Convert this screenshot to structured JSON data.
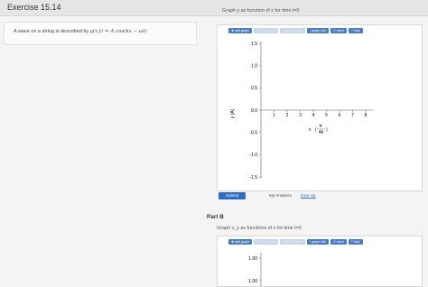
{
  "header": {
    "title": "Exercise 15.14"
  },
  "problem": {
    "text": "A wave on a string is described by",
    "formula": "y(x,t) = A cos(kx − ωt)"
  },
  "partA": {
    "question": "Graph y as function of x for time t=0",
    "toolbar": [
      {
        "label": "✚ add graph",
        "enabled": true
      },
      {
        "label": "✎ add points",
        "enabled": false
      },
      {
        "label": "remove graph",
        "enabled": false
      },
      {
        "label": "⫶ graph info",
        "enabled": true
      },
      {
        "label": "↺ reset",
        "enabled": true
      },
      {
        "label": "? help",
        "enabled": true
      }
    ],
    "plot": {
      "ylabel": "y (A)",
      "xlabel_prefix": "x",
      "xlabel_frac_num": "π",
      "xlabel_frac_den": "4k",
      "y_ticks": [
        "1.5",
        "1.0",
        "0.5",
        "0.0",
        "-0.5",
        "-1.0",
        "-1.5"
      ],
      "x_ticks": [
        "1",
        "2",
        "3",
        "4",
        "5",
        "6",
        "7",
        "8"
      ]
    },
    "submit_label": "Submit",
    "my_answers_label": "My Answers",
    "give_up_label": "Give Up"
  },
  "partB": {
    "title": "Part B",
    "question": "Graph v_y as functions of x for time t=0",
    "toolbar": [
      {
        "label": "✚ add graph",
        "enabled": true
      },
      {
        "label": "✎ add points",
        "enabled": false
      },
      {
        "label": "remove graph",
        "enabled": false
      },
      {
        "label": "⫶ graph info",
        "enabled": true
      },
      {
        "label": "↺ reset",
        "enabled": true
      },
      {
        "label": "? help",
        "enabled": true
      }
    ],
    "y_ticks": [
      "1.50",
      "1.00"
    ]
  },
  "colors": {
    "accent": "#4a7cc0",
    "submit": "#2e6bc4",
    "link": "#2e6bc4"
  }
}
